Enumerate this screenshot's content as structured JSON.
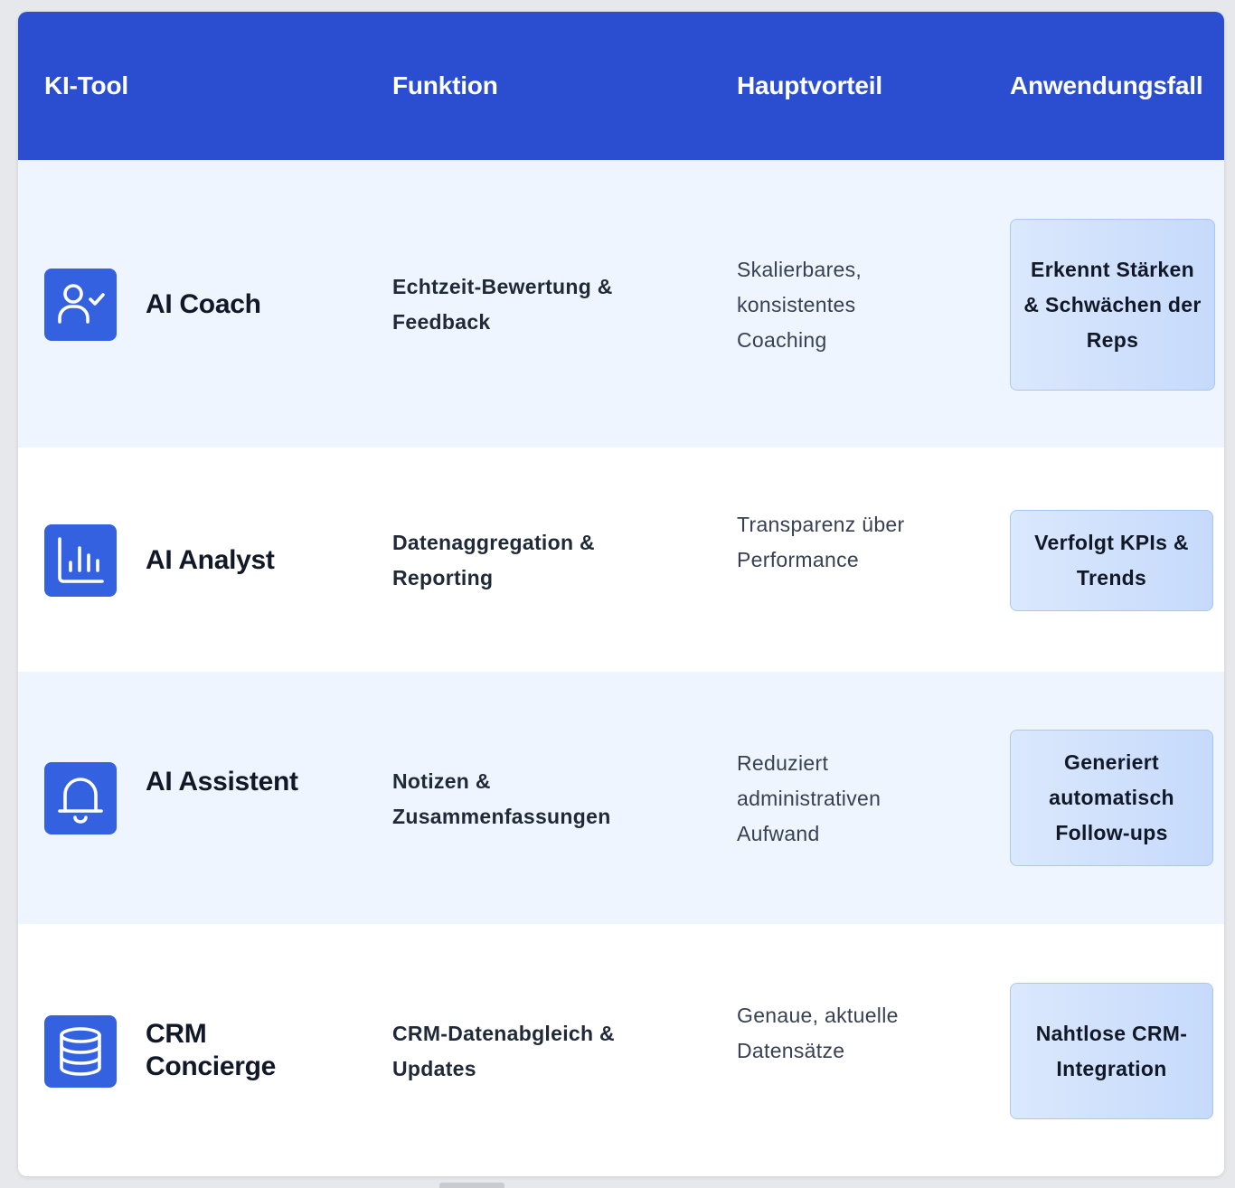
{
  "table": {
    "headers": {
      "tool": "KI-Tool",
      "function": "Funktion",
      "benefit": "Hauptvorteil",
      "usecase": "Anwendungsfall"
    },
    "rows": [
      {
        "icon": "user-check-icon",
        "name": "AI Coach",
        "function": "Echtzeit-Bewertung & Feedback",
        "benefit": "Skalierbares, konsistentes Coaching",
        "usecase": "Erkennt Stärken & Schwächen der Reps"
      },
      {
        "icon": "bar-chart-icon",
        "name": "AI Analyst",
        "function": "Datenaggregation & Reporting",
        "benefit": "Transparenz über Performance",
        "usecase": "Verfolgt KPIs & Trends"
      },
      {
        "icon": "bell-icon",
        "name": "AI Assistent",
        "function": "Notizen & Zusammenfassungen",
        "benefit": "Reduziert administrativen Aufwand",
        "usecase": "Generiert automatisch Follow-ups"
      },
      {
        "icon": "database-icon",
        "name": "CRM Concierge",
        "function": "CRM-Datenabgleich & Updates",
        "benefit": "Genaue, aktuelle Datensätze",
        "usecase": "Nahtlose CRM-Integration"
      }
    ]
  },
  "colors": {
    "header_bg": "#2b4ed0",
    "icon_bg": "#3461e0",
    "row_alt_bg": "#eef5fe",
    "usecase_bg": "#d4e3fc"
  }
}
